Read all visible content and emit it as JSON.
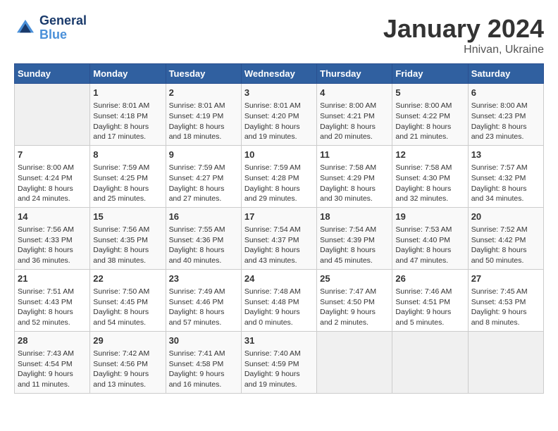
{
  "logo": {
    "line1": "General",
    "line2": "Blue"
  },
  "title": "January 2024",
  "subtitle": "Hnivan, Ukraine",
  "days_of_week": [
    "Sunday",
    "Monday",
    "Tuesday",
    "Wednesday",
    "Thursday",
    "Friday",
    "Saturday"
  ],
  "weeks": [
    [
      {
        "day": "",
        "info": ""
      },
      {
        "day": "1",
        "info": "Sunrise: 8:01 AM\nSunset: 4:18 PM\nDaylight: 8 hours\nand 17 minutes."
      },
      {
        "day": "2",
        "info": "Sunrise: 8:01 AM\nSunset: 4:19 PM\nDaylight: 8 hours\nand 18 minutes."
      },
      {
        "day": "3",
        "info": "Sunrise: 8:01 AM\nSunset: 4:20 PM\nDaylight: 8 hours\nand 19 minutes."
      },
      {
        "day": "4",
        "info": "Sunrise: 8:00 AM\nSunset: 4:21 PM\nDaylight: 8 hours\nand 20 minutes."
      },
      {
        "day": "5",
        "info": "Sunrise: 8:00 AM\nSunset: 4:22 PM\nDaylight: 8 hours\nand 21 minutes."
      },
      {
        "day": "6",
        "info": "Sunrise: 8:00 AM\nSunset: 4:23 PM\nDaylight: 8 hours\nand 23 minutes."
      }
    ],
    [
      {
        "day": "7",
        "info": "Sunrise: 8:00 AM\nSunset: 4:24 PM\nDaylight: 8 hours\nand 24 minutes."
      },
      {
        "day": "8",
        "info": "Sunrise: 7:59 AM\nSunset: 4:25 PM\nDaylight: 8 hours\nand 25 minutes."
      },
      {
        "day": "9",
        "info": "Sunrise: 7:59 AM\nSunset: 4:27 PM\nDaylight: 8 hours\nand 27 minutes."
      },
      {
        "day": "10",
        "info": "Sunrise: 7:59 AM\nSunset: 4:28 PM\nDaylight: 8 hours\nand 29 minutes."
      },
      {
        "day": "11",
        "info": "Sunrise: 7:58 AM\nSunset: 4:29 PM\nDaylight: 8 hours\nand 30 minutes."
      },
      {
        "day": "12",
        "info": "Sunrise: 7:58 AM\nSunset: 4:30 PM\nDaylight: 8 hours\nand 32 minutes."
      },
      {
        "day": "13",
        "info": "Sunrise: 7:57 AM\nSunset: 4:32 PM\nDaylight: 8 hours\nand 34 minutes."
      }
    ],
    [
      {
        "day": "14",
        "info": "Sunrise: 7:56 AM\nSunset: 4:33 PM\nDaylight: 8 hours\nand 36 minutes."
      },
      {
        "day": "15",
        "info": "Sunrise: 7:56 AM\nSunset: 4:35 PM\nDaylight: 8 hours\nand 38 minutes."
      },
      {
        "day": "16",
        "info": "Sunrise: 7:55 AM\nSunset: 4:36 PM\nDaylight: 8 hours\nand 40 minutes."
      },
      {
        "day": "17",
        "info": "Sunrise: 7:54 AM\nSunset: 4:37 PM\nDaylight: 8 hours\nand 43 minutes."
      },
      {
        "day": "18",
        "info": "Sunrise: 7:54 AM\nSunset: 4:39 PM\nDaylight: 8 hours\nand 45 minutes."
      },
      {
        "day": "19",
        "info": "Sunrise: 7:53 AM\nSunset: 4:40 PM\nDaylight: 8 hours\nand 47 minutes."
      },
      {
        "day": "20",
        "info": "Sunrise: 7:52 AM\nSunset: 4:42 PM\nDaylight: 8 hours\nand 50 minutes."
      }
    ],
    [
      {
        "day": "21",
        "info": "Sunrise: 7:51 AM\nSunset: 4:43 PM\nDaylight: 8 hours\nand 52 minutes."
      },
      {
        "day": "22",
        "info": "Sunrise: 7:50 AM\nSunset: 4:45 PM\nDaylight: 8 hours\nand 54 minutes."
      },
      {
        "day": "23",
        "info": "Sunrise: 7:49 AM\nSunset: 4:46 PM\nDaylight: 8 hours\nand 57 minutes."
      },
      {
        "day": "24",
        "info": "Sunrise: 7:48 AM\nSunset: 4:48 PM\nDaylight: 9 hours\nand 0 minutes."
      },
      {
        "day": "25",
        "info": "Sunrise: 7:47 AM\nSunset: 4:50 PM\nDaylight: 9 hours\nand 2 minutes."
      },
      {
        "day": "26",
        "info": "Sunrise: 7:46 AM\nSunset: 4:51 PM\nDaylight: 9 hours\nand 5 minutes."
      },
      {
        "day": "27",
        "info": "Sunrise: 7:45 AM\nSunset: 4:53 PM\nDaylight: 9 hours\nand 8 minutes."
      }
    ],
    [
      {
        "day": "28",
        "info": "Sunrise: 7:43 AM\nSunset: 4:54 PM\nDaylight: 9 hours\nand 11 minutes."
      },
      {
        "day": "29",
        "info": "Sunrise: 7:42 AM\nSunset: 4:56 PM\nDaylight: 9 hours\nand 13 minutes."
      },
      {
        "day": "30",
        "info": "Sunrise: 7:41 AM\nSunset: 4:58 PM\nDaylight: 9 hours\nand 16 minutes."
      },
      {
        "day": "31",
        "info": "Sunrise: 7:40 AM\nSunset: 4:59 PM\nDaylight: 9 hours\nand 19 minutes."
      },
      {
        "day": "",
        "info": ""
      },
      {
        "day": "",
        "info": ""
      },
      {
        "day": "",
        "info": ""
      }
    ]
  ]
}
